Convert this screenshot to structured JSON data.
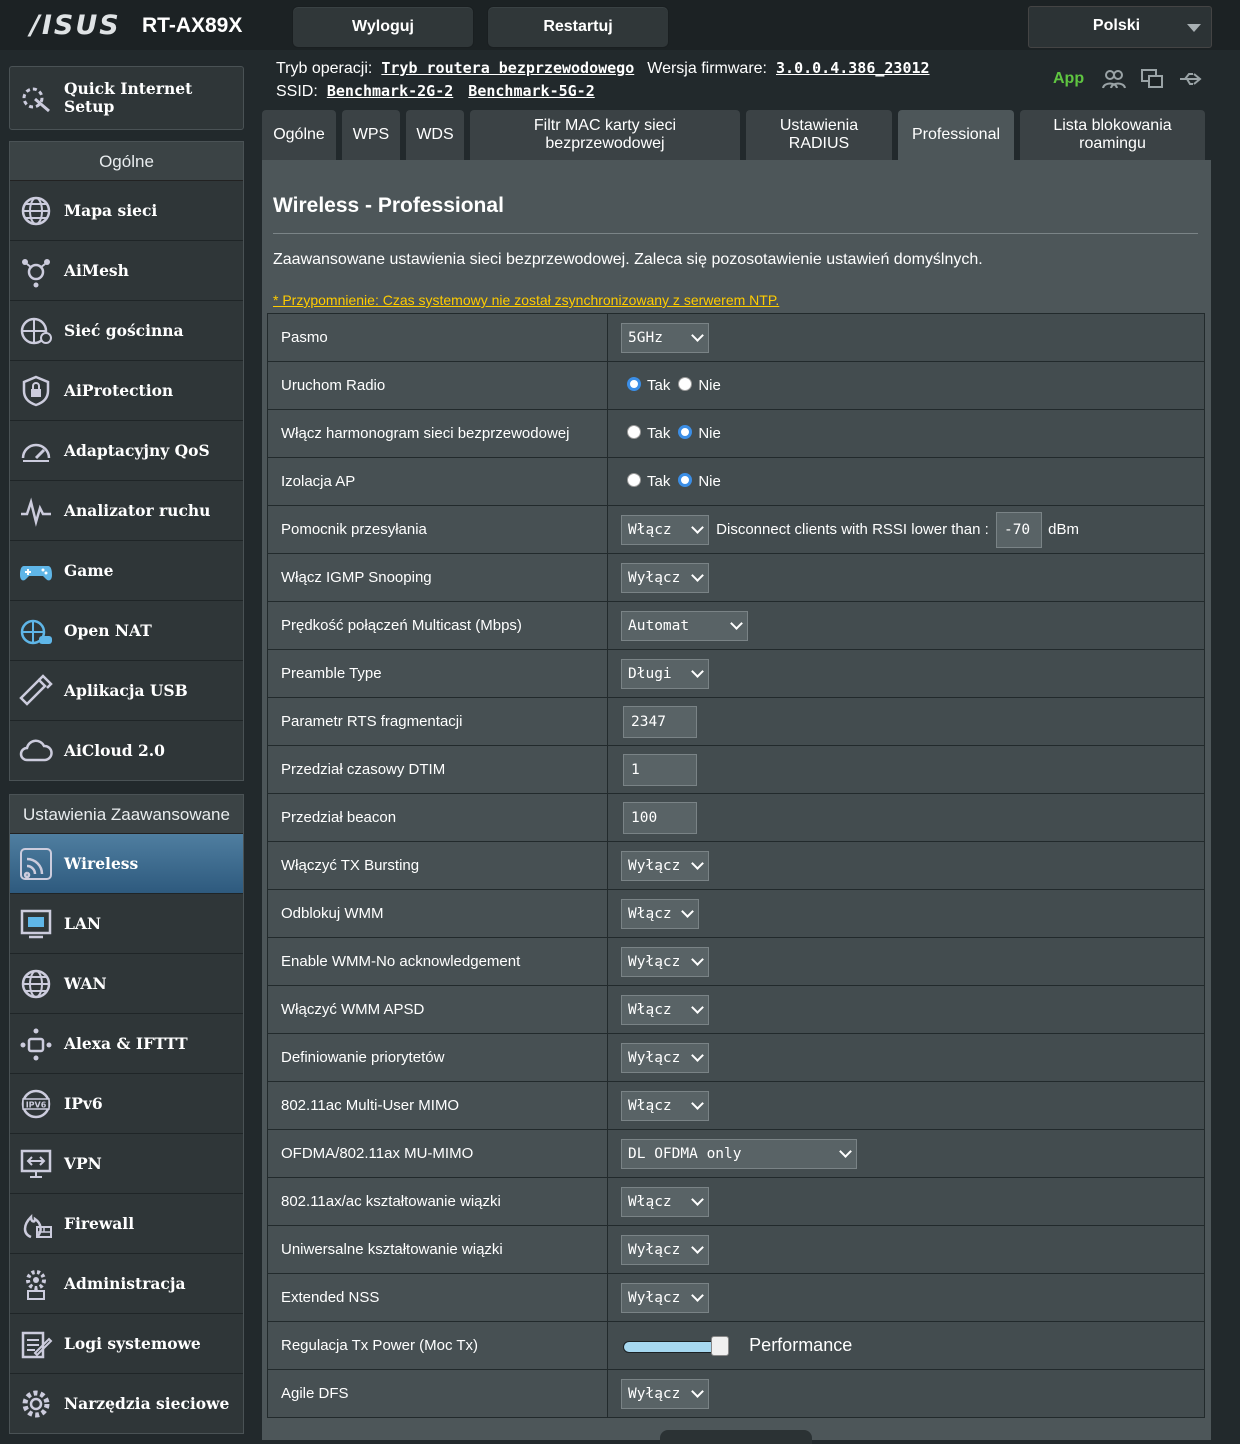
{
  "header": {
    "brand": "/ISUS",
    "model": "RT-AX89X",
    "logout_label": "Wyloguj",
    "restart_label": "Restartuj",
    "language": "Polski"
  },
  "status": {
    "mode_label": "Tryb operacji:",
    "mode_value": "Tryb routera bezprzewodowego",
    "firmware_label": "Wersja firmware:",
    "firmware_value": "3.0.0.4.386_23012",
    "ssid_label": "SSID:",
    "ssid_1": "Benchmark-2G-2",
    "ssid_2": "Benchmark-5G-2",
    "app_label": "App"
  },
  "sidebar": {
    "qis_line1": "Quick Internet",
    "qis_line2": "Setup",
    "general_header": "Ogólne",
    "general_items": [
      {
        "label": "Mapa sieci"
      },
      {
        "label": "AiMesh"
      },
      {
        "label": "Sieć gościnna"
      },
      {
        "label": "AiProtection"
      },
      {
        "label": "Adaptacyjny QoS"
      },
      {
        "label": "Analizator ruchu"
      },
      {
        "label": "Game"
      },
      {
        "label": "Open NAT"
      },
      {
        "label": "Aplikacja USB"
      },
      {
        "label": "AiCloud 2.0"
      }
    ],
    "advanced_header": "Ustawienia Zaawansowane",
    "advanced_items": [
      {
        "label": "Wireless"
      },
      {
        "label": "LAN"
      },
      {
        "label": "WAN"
      },
      {
        "label": "Alexa & IFTTT"
      },
      {
        "label": "IPv6"
      },
      {
        "label": "VPN"
      },
      {
        "label": "Firewall"
      },
      {
        "label": "Administracja"
      },
      {
        "label": "Logi systemowe"
      },
      {
        "label": "Narzędzia sieciowe"
      }
    ]
  },
  "tabs": [
    {
      "label": "Ogólne"
    },
    {
      "label": "WPS"
    },
    {
      "label": "WDS"
    },
    {
      "label": "Filtr MAC karty sieci\nbezprzewodowej"
    },
    {
      "label": "Ustawienia\nRADIUS"
    },
    {
      "label": "Professional"
    },
    {
      "label": "Lista blokowania\nroamingu"
    }
  ],
  "content": {
    "title": "Wireless - Professional",
    "description": "Zaawansowane ustawienia sieci bezprzewodowej. Zaleca się pozosotawienie ustawień domyślnych.",
    "warning": "* Przypomnienie: Czas systemowy nie został zsynchronizowany z serwerem NTP.",
    "radio_yes": "Tak",
    "radio_no": "Nie",
    "rows": [
      {
        "label": "Pasmo",
        "value": "5GHz"
      },
      {
        "label": "Uruchom Radio",
        "value": "Tak"
      },
      {
        "label": "Włącz harmonogram sieci bezprzewodowej",
        "value": "Nie"
      },
      {
        "label": "Izolacja AP",
        "value": "Nie"
      },
      {
        "label": "Pomocnik przesyłania",
        "value": "Włącz",
        "extra_text": "Disconnect clients with RSSI lower than :",
        "rssi": "-70",
        "unit": "dBm"
      },
      {
        "label": "Włącz IGMP Snooping",
        "value": "Wyłącz"
      },
      {
        "label": "Prędkość połączeń Multicast (Mbps)",
        "value": "Automat"
      },
      {
        "label": "Preamble Type",
        "value": "Długi"
      },
      {
        "label": "Parametr RTS fragmentacji",
        "value": "2347"
      },
      {
        "label": "Przedział czasowy DTIM",
        "value": "1"
      },
      {
        "label": "Przedział beacon",
        "value": "100"
      },
      {
        "label": "Włączyć TX Bursting",
        "value": "Wyłącz"
      },
      {
        "label": "Odblokuj WMM",
        "value": "Włącz"
      },
      {
        "label": "Enable WMM-No acknowledgement",
        "value": "Wyłącz"
      },
      {
        "label": "Włączyć WMM APSD",
        "value": "Włącz"
      },
      {
        "label": "Definiowanie priorytetów",
        "value": "Wyłącz"
      },
      {
        "label": "802.11ac Multi-User MIMO",
        "value": "Włącz"
      },
      {
        "label": "OFDMA/802.11ax MU-MIMO",
        "value": "DL OFDMA only"
      },
      {
        "label": "802.11ax/ac kształtowanie wiązki",
        "value": "Włącz"
      },
      {
        "label": "Uniwersalne kształtowanie wiązki",
        "value": "Wyłącz"
      },
      {
        "label": "Extended NSS",
        "value": "Wyłącz"
      },
      {
        "label": "Regulacja Tx Power (Moc Tx)",
        "value": "Performance",
        "level": 1.0
      },
      {
        "label": "Agile DFS",
        "value": "Wyłącz"
      }
    ]
  },
  "colors": {
    "accent": "#3b8ee6",
    "warning": "#ffcc00",
    "app": "#5fc541"
  }
}
